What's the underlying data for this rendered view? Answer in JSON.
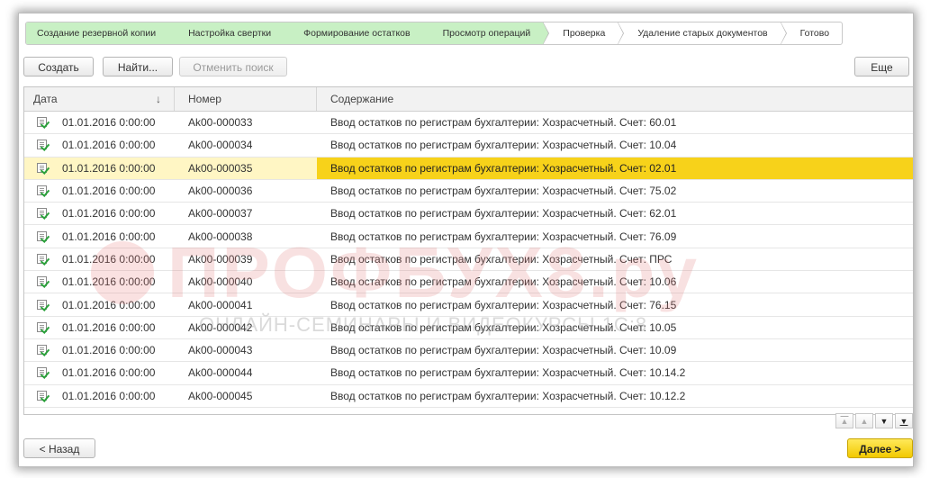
{
  "steps": [
    {
      "label": "Создание резервной копии",
      "done": true
    },
    {
      "label": "Настройка свертки",
      "done": true
    },
    {
      "label": "Формирование остатков",
      "done": true
    },
    {
      "label": "Просмотр операций",
      "done": true
    },
    {
      "label": "Проверка",
      "done": false
    },
    {
      "label": "Удаление старых документов",
      "done": false
    },
    {
      "label": "Готово",
      "done": false
    }
  ],
  "toolbar": {
    "create_label": "Создать",
    "find_label": "Найти...",
    "cancel_search_label": "Отменить поиск",
    "more_label": "Еще"
  },
  "table": {
    "columns": [
      "Дата",
      "Номер",
      "Содержание"
    ],
    "sort_icon": "↓",
    "selected_index": 2,
    "rows": [
      {
        "date": "01.01.2016 0:00:00",
        "number": "Ak00-000033",
        "content": "Ввод остатков по регистрам бухгалтерии: Хозрасчетный. Счет: 60.01"
      },
      {
        "date": "01.01.2016 0:00:00",
        "number": "Ak00-000034",
        "content": "Ввод остатков по регистрам бухгалтерии: Хозрасчетный. Счет: 10.04"
      },
      {
        "date": "01.01.2016 0:00:00",
        "number": "Ak00-000035",
        "content": "Ввод остатков по регистрам бухгалтерии: Хозрасчетный. Счет: 02.01"
      },
      {
        "date": "01.01.2016 0:00:00",
        "number": "Ak00-000036",
        "content": "Ввод остатков по регистрам бухгалтерии: Хозрасчетный. Счет: 75.02"
      },
      {
        "date": "01.01.2016 0:00:00",
        "number": "Ak00-000037",
        "content": "Ввод остатков по регистрам бухгалтерии: Хозрасчетный. Счет: 62.01"
      },
      {
        "date": "01.01.2016 0:00:00",
        "number": "Ak00-000038",
        "content": "Ввод остатков по регистрам бухгалтерии: Хозрасчетный. Счет: 76.09"
      },
      {
        "date": "01.01.2016 0:00:00",
        "number": "Ak00-000039",
        "content": "Ввод остатков по регистрам бухгалтерии: Хозрасчетный. Счет: ПРС"
      },
      {
        "date": "01.01.2016 0:00:00",
        "number": "Ak00-000040",
        "content": "Ввод остатков по регистрам бухгалтерии: Хозрасчетный. Счет: 10.06"
      },
      {
        "date": "01.01.2016 0:00:00",
        "number": "Ak00-000041",
        "content": "Ввод остатков по регистрам бухгалтерии: Хозрасчетный. Счет: 76.15"
      },
      {
        "date": "01.01.2016 0:00:00",
        "number": "Ak00-000042",
        "content": "Ввод остатков по регистрам бухгалтерии: Хозрасчетный. Счет: 10.05"
      },
      {
        "date": "01.01.2016 0:00:00",
        "number": "Ak00-000043",
        "content": "Ввод остатков по регистрам бухгалтерии: Хозрасчетный. Счет: 10.09"
      },
      {
        "date": "01.01.2016 0:00:00",
        "number": "Ak00-000044",
        "content": "Ввод остатков по регистрам бухгалтерии: Хозрасчетный. Счет: 10.14.2"
      },
      {
        "date": "01.01.2016 0:00:00",
        "number": "Ak00-000045",
        "content": "Ввод остатков по регистрам бухгалтерии: Хозрасчетный. Счет: 10.12.2"
      }
    ]
  },
  "watermark": {
    "title": "ПРОФБУХ8.ру",
    "subtitle": "ОНЛАЙН-СЕМИНАРЫ И ВИДЕОКУРСЫ 1С:8"
  },
  "footer": {
    "back_label": "< Назад",
    "next_label": "Далее >"
  },
  "icons": {
    "row_icon": "document-posted-icon",
    "scroll_first": "▲",
    "scroll_up": "▲",
    "scroll_down": "▼",
    "scroll_last": "▼"
  },
  "colors": {
    "step_done": "#c8f0c4",
    "selected_row": "#f7d21a",
    "selected_row_light": "#fff6c4",
    "primary_button": "#f2c900"
  }
}
